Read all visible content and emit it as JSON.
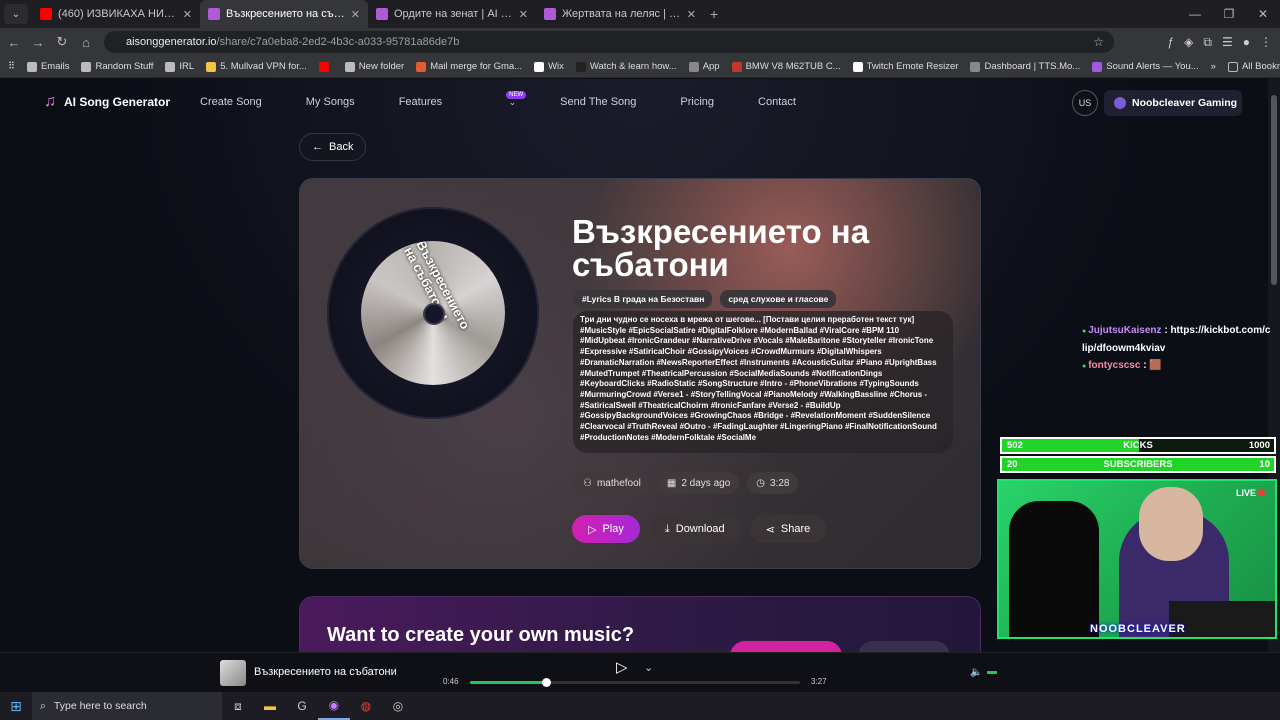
{
  "browser": {
    "tabs": [
      {
        "title": "(460) ИЗВИКАХА НИ ПОЛИЦИ",
        "color": "#ff0000",
        "active": false
      },
      {
        "title": "Възкресението на събатони |",
        "color": "#b05ad8",
        "active": true
      },
      {
        "title": "Ордите на зенат | AI Song Gen",
        "color": "#b05ad8",
        "active": false
      },
      {
        "title": "Жертвата на леляс | AI Song G",
        "color": "#b05ad8",
        "active": false
      }
    ],
    "url_host": "aisonggenerator.io",
    "url_path": "/share/c7a0eba8-2ed2-4b3c-a033-95781a86de7b",
    "bookmarks": [
      "Emails",
      "Random Stuff",
      "IRL",
      "5. Mullvad VPN for...",
      "",
      "New folder",
      "Mail merge for Gma...",
      "Wix",
      "Watch & learn how...",
      "App",
      "BMW V8 M62TUB C...",
      "Twitch Emote Resizer",
      "Dashboard | TTS.Mo...",
      "Sound Alerts — You..."
    ],
    "all_bookmarks": "All Bookmarks"
  },
  "site": {
    "logo": "AI Song Generator",
    "menu": [
      "Create Song",
      "My Songs",
      "Features",
      "Send The Song",
      "Pricing",
      "Contact"
    ],
    "new_badge": "NEW",
    "lang": "US",
    "user": "Noobcleaver Gaming"
  },
  "song": {
    "back": "Back",
    "title": "Възкресението на събатони",
    "disc_text": "Възкресението на събатони",
    "tags": [
      "#Lyrics В града на Безоставн",
      "сред слухове и гласове"
    ],
    "lyrics": "Три дни чудно се носеха в мрежа от шегове... [Постави целия преработен текст тук] #MusicStyle #EpicSocialSatire #DigitalFolklore #ModernBallad #ViralCore #BPM 110 #MidUpbeat #IronicGrandeur #NarrativeDrive #Vocals #MaleBaritone #Storyteller #IronicTone #Expressive #SatiricalChoir #GossipyVoices #CrowdMurmurs #DigitalWhispers #DramaticNarration #NewsReporterEffect #Instruments #AcousticGuitar #Piano #UprightBass #MutedTrumpet #TheatricalPercussion #SocialMediaSounds #NotificationDings #KeyboardClicks #RadioStatic #SongStructure #Intro - #PhoneVibrations #TypingSounds #MurmuringCrowd #Verse1 - #StoryTellingVocal #PianoMelody #WalkingBassline #Chorus - #SatiricalSwell #TheatricalChoirm #IronicFanfare #Verse2 - #BuildUp #GossipyBackgroundVoices #GrowingChaos #Bridge - #RevelationMoment #SuddenSilence #Clearvocal #TruthReveal #Outro - #FadingLaughter #LingeringPiano #FinalNotificationSound #ProductionNotes #ModernFolktale #SocialMe",
    "author": "mathefool",
    "date": "2 days ago",
    "duration": "3:28",
    "play": "Play",
    "download": "Download",
    "share": "Share"
  },
  "promo": {
    "heading": "Want to create your own music?"
  },
  "stream": {
    "chat": [
      {
        "user": "JujutsuKaisenz",
        "msg": "https://kickbot.com/clip/dfoowm4kviav"
      },
      {
        "user": "fontycscsc",
        "msg": "🟫"
      }
    ],
    "kicks": {
      "current": "502",
      "label": "KICKS",
      "goal": "1000",
      "progress": 0.502
    },
    "subs": {
      "current": "20",
      "label": "SUBSCRIBERS",
      "goal": "10",
      "progress": 1.0
    },
    "live": "LIVE",
    "name": "NOOBCLEAVER"
  },
  "player": {
    "title": "Възкресението на събатони",
    "current": "0:46",
    "total": "3:27",
    "progress": 0.23
  },
  "taskbar": {
    "search_placeholder": "Type here to search"
  }
}
